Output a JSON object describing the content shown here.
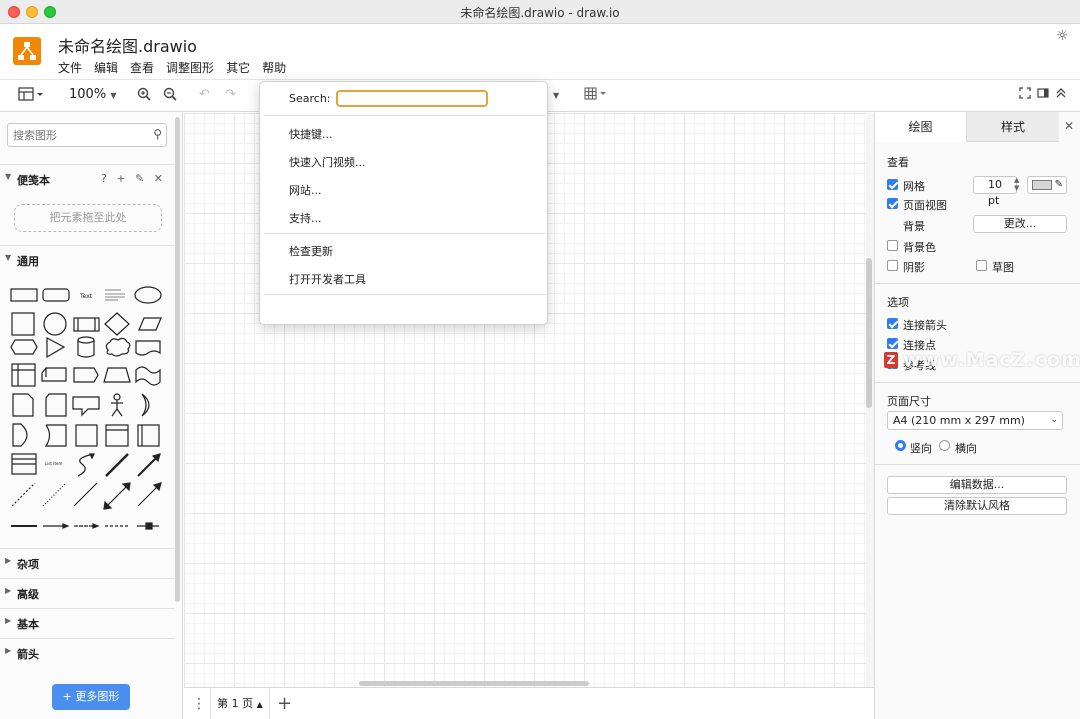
{
  "window": {
    "title": "未命名绘图.drawio - draw.io"
  },
  "header": {
    "doc_title": "未命名绘图.drawio",
    "menus": [
      "文件",
      "编辑",
      "查看",
      "调整图形",
      "其它",
      "帮助"
    ]
  },
  "toolbar": {
    "zoom": "100%"
  },
  "help_menu": {
    "search_label": "Search:",
    "search_value": "",
    "items_group1": [
      "快捷键...",
      "快速入门视频...",
      "网站...",
      "支持..."
    ],
    "items_group2": [
      "检查更新",
      "打开开发者工具"
    ]
  },
  "sidebar": {
    "search_placeholder": "搜索图形",
    "scratchpad_title": "便笺本",
    "scratchpad_icons": [
      "?",
      "+",
      "✎",
      "✕"
    ],
    "drop_hint": "把元素拖至此处",
    "general_title": "通用",
    "sections": [
      "杂项",
      "高级",
      "基本",
      "箭头"
    ],
    "more_shapes": "+ 更多图形",
    "shape_text_label": "Text",
    "shape_list_label": "List Item"
  },
  "page_tabs": {
    "current": "第 1 页"
  },
  "format_panel": {
    "tab_diagram": "绘图",
    "tab_style": "样式",
    "view_title": "查看",
    "grid_label": "网格",
    "grid_checked": true,
    "grid_size": "10 pt",
    "page_view_label": "页面视图",
    "page_view_checked": true,
    "background_label": "背景",
    "change_button": "更改...",
    "background_color_label": "背景色",
    "background_color_checked": false,
    "shadow_label": "阴影",
    "shadow_checked": false,
    "sketch_label": "草图",
    "sketch_checked": false,
    "options_title": "选项",
    "connection_arrows_label": "连接箭头",
    "connection_arrows_checked": true,
    "connection_points_label": "连接点",
    "connection_points_checked": true,
    "guides_label": "参考线",
    "page_size_title": "页面尺寸",
    "page_size_value": "A4 (210 mm x 297 mm)",
    "portrait_label": "竖向",
    "portrait_checked": true,
    "landscape_label": "横向",
    "edit_data_button": "编辑数据...",
    "clear_style_button": "清除默认风格"
  },
  "watermark": {
    "text": "www.MacZ.com",
    "badge": "Z"
  }
}
